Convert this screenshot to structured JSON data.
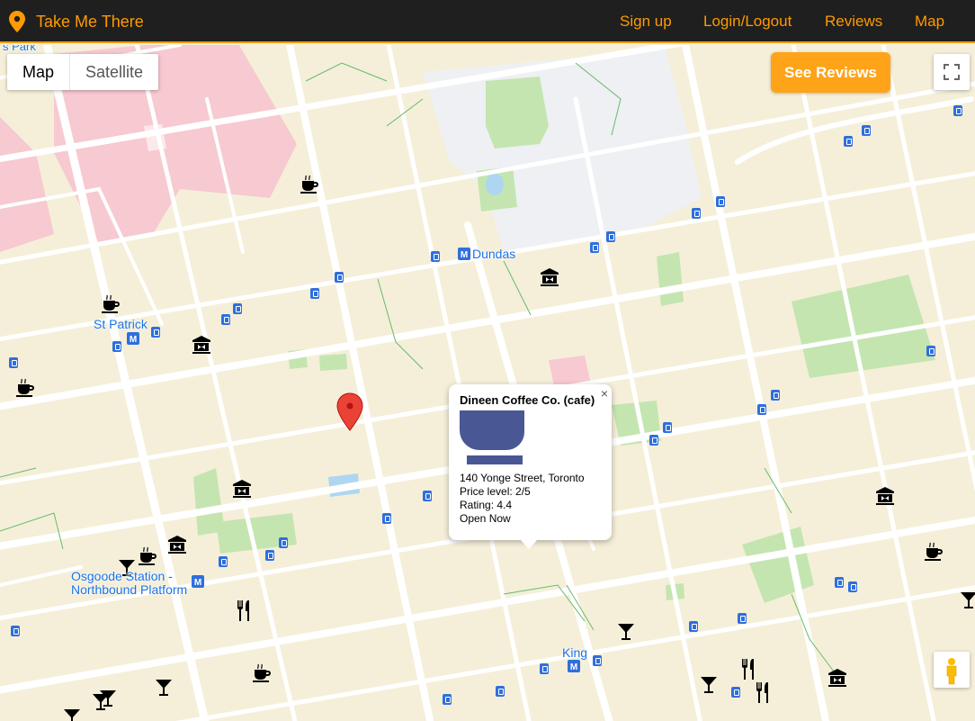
{
  "navbar": {
    "brand": "Take Me There",
    "links": [
      "Sign up",
      "Login/Logout",
      "Reviews",
      "Map"
    ]
  },
  "map": {
    "type_control": {
      "map": "Map",
      "satellite": "Satellite"
    },
    "see_reviews": "See Reviews",
    "labels": {
      "top_left": "s Park",
      "dundas": "Dundas",
      "st_patrick": "St Patrick",
      "osgoode_1": "Osgoode Station -",
      "osgoode_2": "Northbound Platform",
      "king": "King"
    },
    "infowindow": {
      "title": "Dineen Coffee Co. (cafe)",
      "address": "140 Yonge Street, Toronto",
      "price": "Price level: 2/5",
      "rating": "Rating: 4.4",
      "status": "Open Now",
      "close": "×"
    }
  },
  "colors": {
    "accent": "#ff9a00",
    "navbar_bg": "#1f1f1f",
    "map_bg": "#f5efd9",
    "park": "#c4e5b0",
    "road": "#ffffff",
    "transit": "#2f6fde",
    "cafe_icon": "#4a5795",
    "marker": "#ea4335"
  }
}
